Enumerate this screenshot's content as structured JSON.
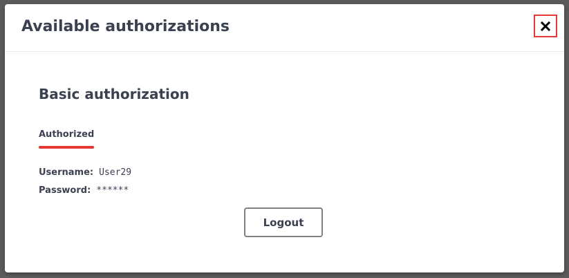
{
  "modal": {
    "title": "Available authorizations",
    "close_icon": "close-icon"
  },
  "auth": {
    "title": "Basic authorization",
    "status": "Authorized",
    "status_color": "#e53935",
    "username_label": "Username:",
    "username_value": "User29",
    "password_label": "Password:",
    "password_value": "******",
    "logout_label": "Logout"
  }
}
